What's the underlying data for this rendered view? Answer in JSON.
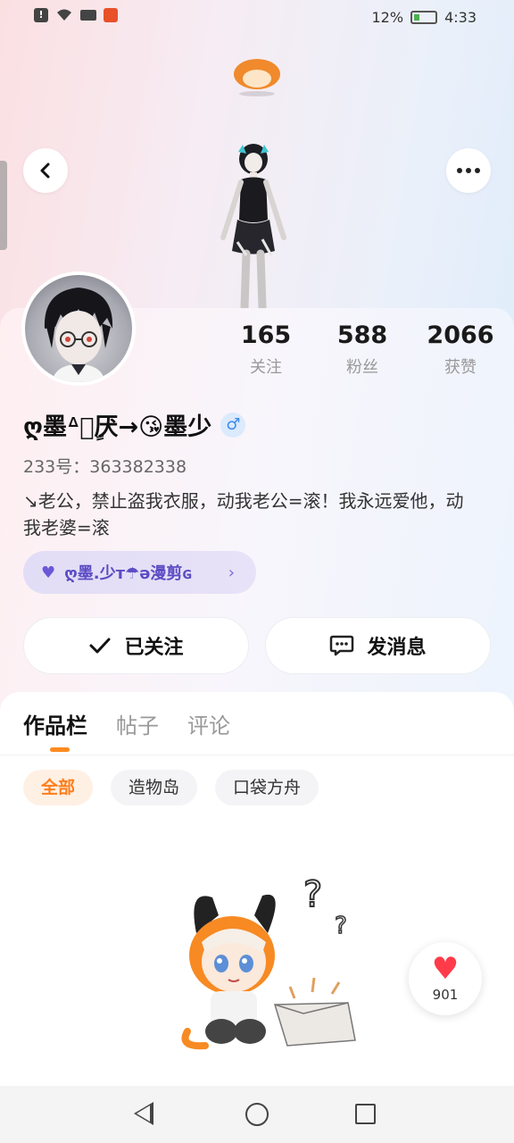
{
  "status_bar": {
    "battery_percent": "12%",
    "time": "4:33"
  },
  "profile": {
    "stats": [
      {
        "value": "165",
        "label": "关注"
      },
      {
        "value": "588",
        "label": "粉丝"
      },
      {
        "value": "2066",
        "label": "获赞"
      }
    ],
    "nickname": "ღ墨ᐞ沈ٍ厌→😘墨少",
    "gender_icon": "♂",
    "uid": "233号：363382338",
    "bio": "↘老公，禁止盗我衣服，动我老公=滚！我永远爱他，动我老婆=滚",
    "tag_label": "ღ墨.少ᴛ☂ə漫剪ɢ"
  },
  "actions": {
    "follow_label": "已关注",
    "message_label": "发消息"
  },
  "tabs": [
    {
      "label": "作品栏",
      "active": true
    },
    {
      "label": "帖子",
      "active": false
    },
    {
      "label": "评论",
      "active": false
    }
  ],
  "filter_chips": [
    {
      "label": "全部",
      "active": true
    },
    {
      "label": "造物岛",
      "active": false
    },
    {
      "label": "口袋方舟",
      "active": false
    }
  ],
  "like_fab": {
    "count": "901"
  },
  "colors": {
    "accent": "#ff7d1a",
    "like_red": "#ff3b4a",
    "tag_purple": "#5b4bc4"
  }
}
